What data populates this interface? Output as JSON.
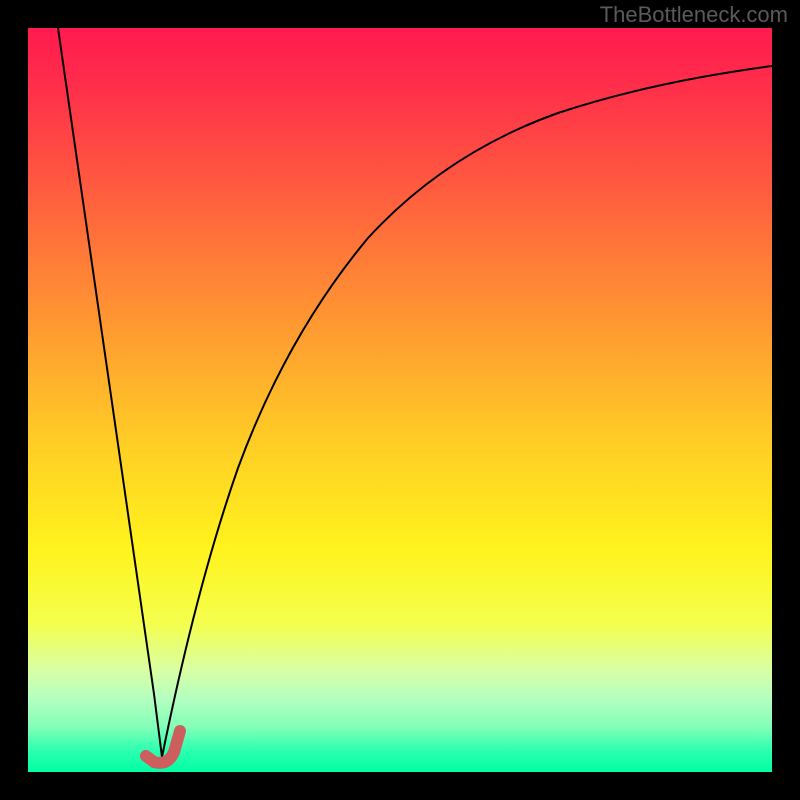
{
  "watermark": "TheBottleneck.com",
  "chart_data": {
    "type": "line",
    "title": "",
    "xlabel": "",
    "ylabel": "",
    "xlim": [
      0,
      100
    ],
    "ylim": [
      0,
      100
    ],
    "series": [
      {
        "name": "curve-left",
        "x": [
          4,
          6,
          8,
          10,
          12,
          14,
          16,
          17
        ],
        "values": [
          100,
          85,
          70,
          55,
          40,
          25,
          10,
          2
        ]
      },
      {
        "name": "curve-right",
        "x": [
          17,
          19,
          22,
          26,
          30,
          35,
          40,
          46,
          52,
          60,
          68,
          76,
          84,
          92,
          100
        ],
        "values": [
          2,
          10,
          22,
          36,
          48,
          58,
          66,
          73,
          79,
          84,
          88,
          91,
          93,
          94.5,
          95.5
        ]
      }
    ],
    "annotations": [
      {
        "name": "j-marker",
        "x": 17,
        "y": 2
      }
    ],
    "background": "red-yellow-green-vertical-gradient"
  }
}
